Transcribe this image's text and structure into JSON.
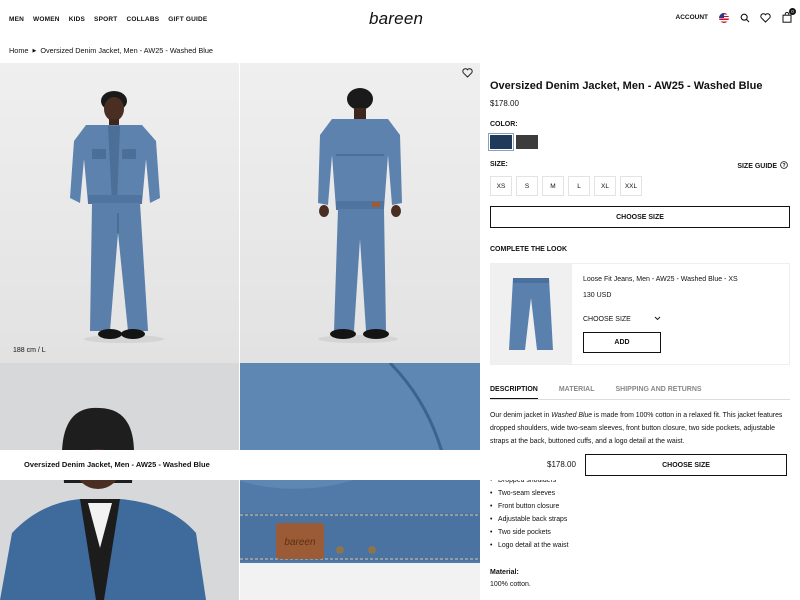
{
  "header": {
    "nav": [
      "MEN",
      "WOMEN",
      "KIDS",
      "SPORT",
      "COLLABS",
      "GIFT GUIDE"
    ],
    "logo": "bareen",
    "account": "ACCOUNT",
    "cart_count": "0"
  },
  "breadcrumb": {
    "home": "Home",
    "current": "Oversized Denim Jacket, Men - AW25 - Washed Blue"
  },
  "gallery": {
    "model_height": "188 cm / L",
    "label_text": "bareen"
  },
  "product": {
    "title": "Oversized Denim Jacket, Men - AW25 - Washed Blue",
    "price": "$178.00",
    "color_label": "COLOR:",
    "colors": [
      "#203a5c",
      "#3c3c3c"
    ],
    "size_label": "SIZE:",
    "size_guide": "SIZE GUIDE",
    "sizes": [
      "XS",
      "S",
      "M",
      "L",
      "XL",
      "XXL"
    ],
    "choose_size": "CHOOSE SIZE"
  },
  "complete_the_look": {
    "heading": "COMPLETE THE LOOK",
    "name": "Loose Fit Jeans, Men - AW25 - Washed Blue - XS",
    "price": "130 USD",
    "select": "CHOOSE SIZE",
    "add": "ADD"
  },
  "tabs": [
    "DESCRIPTION",
    "MATERIAL",
    "SHIPPING AND RETURNS"
  ],
  "description": {
    "text_before": "Our denim jacket in ",
    "text_italic": "Washed Blue",
    "text_after": " is made from 100% cotton in a relaxed fit. This jacket features dropped shoulders, wide two-seam sleeves, front button closure, two side pockets, adjustable straps at the back, buttoned cuffs, and a logo detail at the waist.",
    "bullets": [
      "Dropped shoulders",
      "Two-seam sleeves",
      "Front button closure",
      "Adjustable back straps",
      "Two side pockets",
      "Logo detail at the waist"
    ],
    "material_label": "Material:",
    "material": "100% cotton."
  },
  "sticky": {
    "name": "Oversized Denim Jacket, Men - AW25 - Washed Blue",
    "price": "$178.00",
    "button": "CHOOSE SIZE"
  }
}
